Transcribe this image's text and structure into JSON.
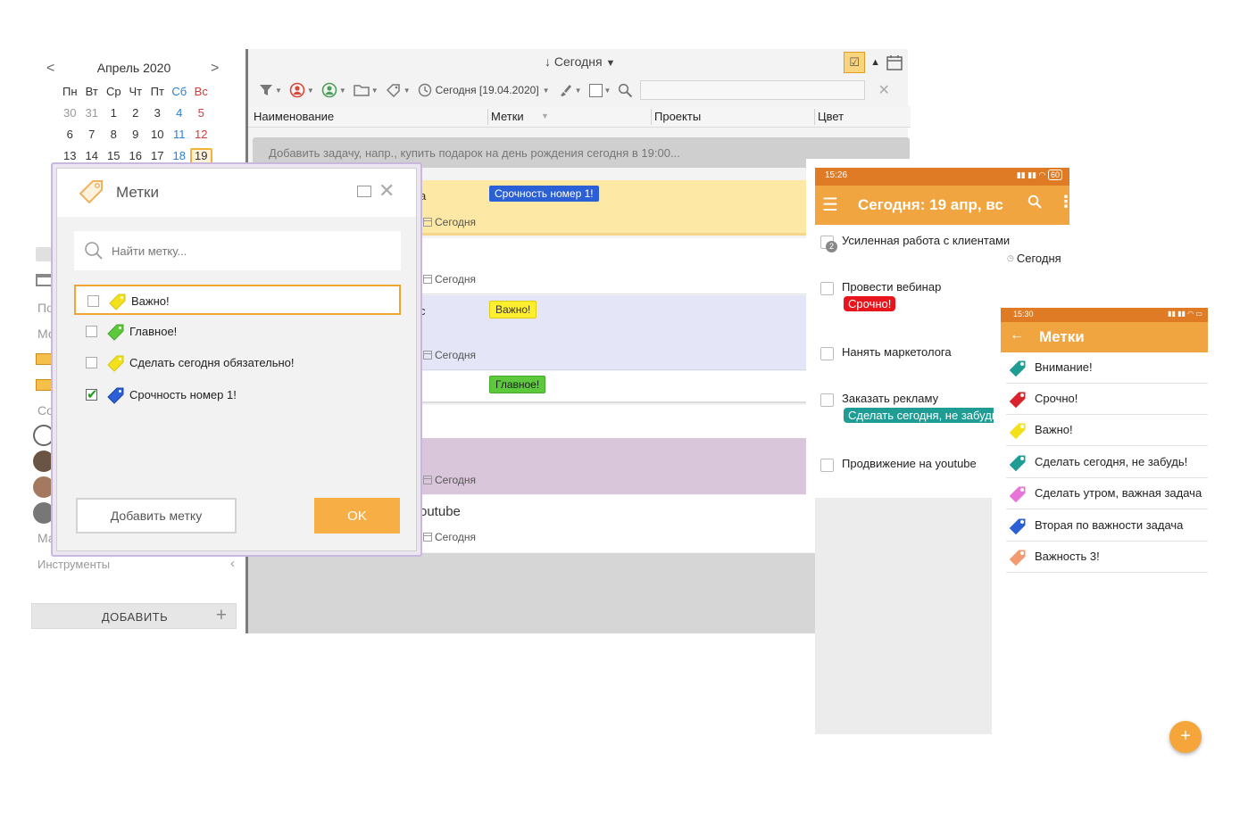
{
  "calendar": {
    "month": "Апрель 2020",
    "prev": "<",
    "next": ">",
    "weekdays": [
      "Пн",
      "Вт",
      "Ср",
      "Чт",
      "Пт",
      "Сб",
      "Вс"
    ],
    "days": [
      "30",
      "31",
      "1",
      "2",
      "3",
      "4",
      "5",
      "6",
      "7",
      "8",
      "9",
      "10",
      "11",
      "12",
      "13",
      "14",
      "15",
      "16",
      "17",
      "18",
      "19"
    ]
  },
  "sidebar": {
    "fragments": [
      "По",
      "Мо",
      "Co",
      "Ма"
    ],
    "tools_label": "Инструменты",
    "add_label": "ДОБАВИТЬ"
  },
  "main": {
    "sort_label": "↓ Сегодня",
    "date_filter": "Сегодня [19.04.2020]",
    "columns": [
      "Наименование",
      "Метки",
      "Проекты",
      "Цвет"
    ],
    "quick_add_placeholder": "Добавить задачу, напр., купить подарок на день рождения сегодня в 19:00...",
    "due_label": "Сегодня",
    "fragments": {
      "row1": "а",
      "row3": "с",
      "row6": "outube"
    },
    "tags": {
      "row1": "Срочность номер 1!",
      "row3": "Важно!",
      "row4": "Главное!"
    }
  },
  "dialog": {
    "title": "Метки",
    "search_placeholder": "Найти метку...",
    "items": [
      {
        "label": "Важно!",
        "color": "#f2e11c",
        "checked": false
      },
      {
        "label": "Главное!",
        "color": "#5cc93d",
        "checked": false
      },
      {
        "label": "Сделать сегодня обязательно!",
        "color": "#f2e11c",
        "checked": false
      },
      {
        "label": "Срочность номер 1!",
        "color": "#2a5fd6",
        "checked": true
      }
    ],
    "add_button": "Добавить метку",
    "ok_button": "OK"
  },
  "phone1": {
    "time": "15:26",
    "battery": "60",
    "title": "Сегодня: 19 апр, вс",
    "badge": "2",
    "tasks": [
      {
        "title": "Усиленная работа с клиентами",
        "due": "Сегодня"
      },
      {
        "title": "Провести вебинар",
        "chip": "Срочно!"
      },
      {
        "title": "Нанять маркетолога"
      },
      {
        "title": "Заказать рекламу",
        "chip": "Сделать сегодня, не забудь!"
      },
      {
        "title": "Продвижение на youtube"
      }
    ]
  },
  "phone2": {
    "time": "15:30",
    "title": "Метки",
    "tags": [
      {
        "label": "Внимание!",
        "color": "#1f9c94"
      },
      {
        "label": "Срочно!",
        "color": "#d9232d"
      },
      {
        "label": "Важно!",
        "color": "#f2e11c"
      },
      {
        "label": "Сделать сегодня, не забудь!",
        "color": "#1f9c94"
      },
      {
        "label": "Сделать утром, важная задача",
        "color": "#e774d9"
      },
      {
        "label": "Вторая по важности задача",
        "color": "#2a5fd6"
      },
      {
        "label": "Важность 3!",
        "color": "#f29a72"
      }
    ]
  },
  "colors": {
    "accent_orange": "#f1a540",
    "status_orange": "#e07b25",
    "tag_blue": "#2a5fd6",
    "tag_yellow": "#ffef2e",
    "tag_green": "#5cc93d",
    "chip_red": "#e8151d",
    "chip_teal": "#1f9c94"
  }
}
